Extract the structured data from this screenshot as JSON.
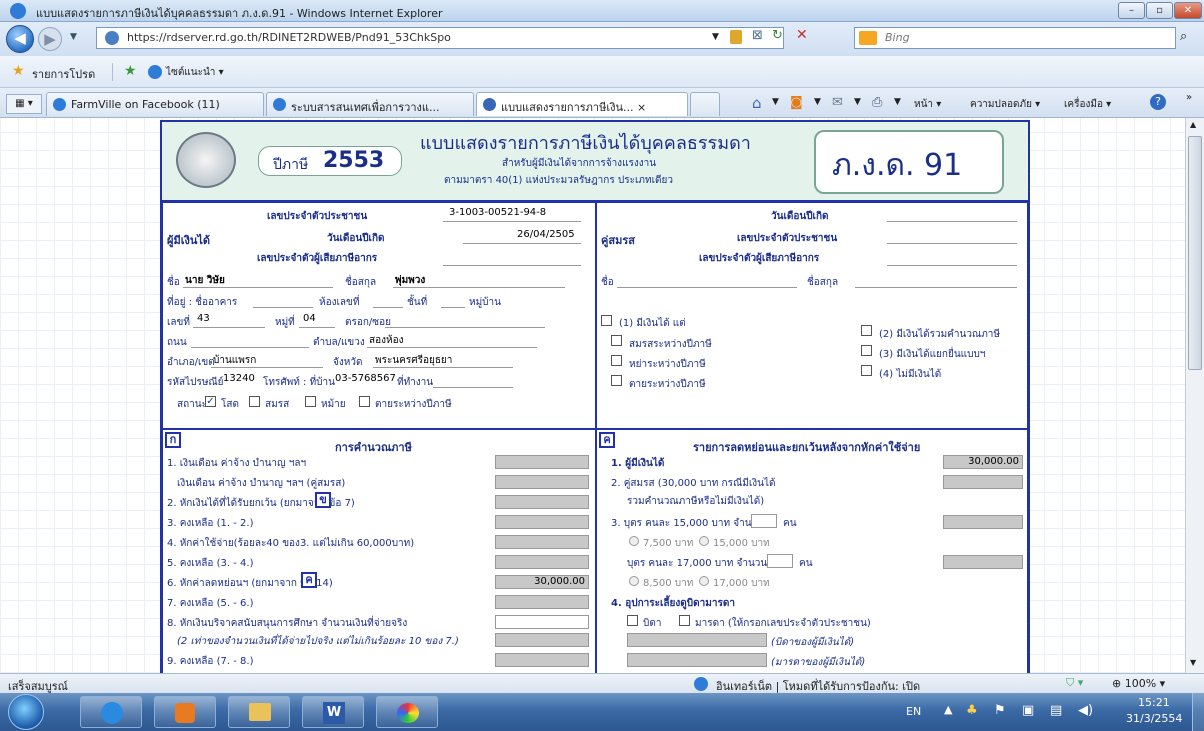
{
  "window": {
    "title": "แบบแสดงรายการภาษีเงินได้บุคคลธรรมดา ภ.ง.ด.91 - Windows Internet Explorer"
  },
  "address": {
    "url": "https://rdserver.rd.go.th/RDINET2RDWEB/Pnd91_53ChkSpo",
    "search_placeholder": "Bing"
  },
  "favorites": {
    "label": "รายการโปรด",
    "suggested": "ไซต์แนะนำ ▾"
  },
  "tabs": [
    {
      "label": "FarmVille on Facebook (11)"
    },
    {
      "label": "ระบบสารสนเทศเพื่อการวางแ..."
    },
    {
      "label": "แบบแสดงรายการภาษีเงิน... ×"
    }
  ],
  "commandbar": {
    "page": "หน้า ▾",
    "safety": "ความปลอดภัย ▾",
    "tools": "เครื่องมือ ▾"
  },
  "form": {
    "year_label": "ปีภาษี",
    "year": "2553",
    "title": "แบบแสดงรายการภาษีเงินได้บุคคลธรรมดา",
    "subtitle1": "สำหรับผู้มีเงินได้จากการจ้างแรงงาน",
    "subtitle2": "ตามมาตรา 40(1) แห่งประมวลรัษฎากร ประเภทเดียว",
    "form_code": "ภ.ง.ด. 91",
    "payer": {
      "heading": "ผู้มีเงินได้",
      "id_label": "เลขประจำตัวประชาชน",
      "id_value": "3-1003-00521-94-8",
      "birth_label": "วันเดือนปีเกิด",
      "birth_value": "26/04/2505",
      "tax_id_label": "เลขประจำตัวผู้เสียภาษีอากร",
      "name_label": "ชื่อ",
      "name_value": "นาย วิษัย",
      "surname_label": "ชื่อสกุล",
      "surname_value": "พุ่มพวง",
      "address_label": "ที่อยู่ : ชื่ออาคาร",
      "room_label": "ห้องเลขที่",
      "floor_label": "ชั้นที่",
      "village_label": "หมู่บ้าน",
      "house_no_label": "เลขที่",
      "house_no": "43",
      "moo_label": "หมู่ที่",
      "moo": "04",
      "soi_label": "ตรอก/ซอย",
      "road_label": "ถนน",
      "subdistrict_label": "ตำบล/แขวง",
      "subdistrict": "สองห้อง",
      "district_label": "อำเภอ/เขต",
      "district": "บ้านแพรก",
      "province_label": "จังหวัด",
      "province": "พระนครศรีอยุธยา",
      "postal_label": "รหัสไปรษณีย์",
      "postal": "13240",
      "phone_label": "โทรศัพท์ : ที่บ้าน",
      "phone": "03-5768567",
      "work_label": "ที่ทำงาน",
      "status_label": "สถานะ",
      "status_single": "โสด",
      "status_married": "สมรส",
      "status_widowed": "หม้าย",
      "status_died": "ตายระหว่างปีภาษี"
    },
    "spouse": {
      "heading": "คู่สมรส",
      "birth_label": "วันเดือนปีเกิด",
      "id_label": "เลขประจำตัวประชาชน",
      "tax_id_label": "เลขประจำตัวผู้เสียภาษีอากร",
      "name_label": "ชื่อ",
      "surname_label": "ชื่อสกุล",
      "opt1": "(1) มีเงินได้ แต่",
      "opt1a": "สมรสระหว่างปีภาษี",
      "opt1b": "หย่าระหว่างปีภาษี",
      "opt1c": "ตายระหว่างปีภาษี",
      "opt2": "(2) มีเงินได้รวมคำนวณภาษี",
      "opt3": "(3) มีเงินได้แยกยื่นแบบฯ",
      "opt4": "(4) ไม่มีเงินได้"
    },
    "calc": {
      "badge": "ก",
      "heading": "การคำนวณภาษี",
      "rows": [
        "1. เงินเดือน ค่าจ้าง บำนาญ ฯลฯ",
        "เงินเดือน ค่าจ้าง บำนาญ ฯลฯ (คู่สมรส)",
        "2. หักเงินได้ที่ได้รับยกเว้น (ยกมาจาก ข้อ 7)",
        "3. คงเหลือ (1. - 2.)",
        "4. หักค่าใช้จ่าย(ร้อยละ40 ของ3. แต่ไม่เกิน 60,000บาท)",
        "5. คงเหลือ (3. - 4.)",
        "6. หักค่าลดหย่อนฯ (ยกมาจาก ข้อ 14)",
        "7. คงเหลือ (5. - 6.)",
        "8. หักเงินบริจาคสนับสนุนการศึกษา จำนวนเงินที่จ่ายจริง",
        "(2 เท่าของจำนวนเงินที่ได้จ่ายไปจริง แต่ไม่เกินร้อยละ 10 ของ 7.)",
        "9. คงเหลือ (7. - 8.)"
      ],
      "badge_ref_2": "ข",
      "badge_ref_6": "ค",
      "row6_value": "30,000.00"
    },
    "deduct": {
      "badge": "ค",
      "heading": "รายการลดหย่อนและยกเว้นหลังจากหักค่าใช้จ่าย",
      "r1": "1. ผู้มีเงินได้",
      "r1_value": "30,000.00",
      "r2": "2. คู่สมรส (30,000 บาท กรณีมีเงินได้",
      "r2b": "รวมคำนวณภาษีหรือไม่มีเงินได้)",
      "r3": "3. บุตร คนละ 15,000 บาท จำนวน",
      "r3_unit": "คน",
      "r3_opt1": "7,500 บาท",
      "r3_opt2": "15,000 บาท",
      "r3b": "บุตร คนละ 17,000 บาท จำนวน",
      "r3b_unit": "คน",
      "r3b_opt1": "8,500 บาท",
      "r3b_opt2": "17,000 บาท",
      "r4": "4. อุปการะเลี้ยงดูบิดามารดา",
      "r4_father": "บิดา",
      "r4_mother": "มารดา (ให้กรอกเลขประจำตัวประชาชน)",
      "r4_f_note": "(บิดาของผู้มีเงินได้)",
      "r4_m_note": "(มารดาของผู้มีเงินได้)"
    }
  },
  "status": {
    "left": "เสร็จสมบูรณ์",
    "zone": "อินเทอร์เน็ต | โหมดที่ได้รับการป้องกัน: เปิด",
    "zoom": "100%"
  },
  "taskbar": {
    "lang": "EN",
    "time": "15:21",
    "date": "31/3/2554"
  }
}
